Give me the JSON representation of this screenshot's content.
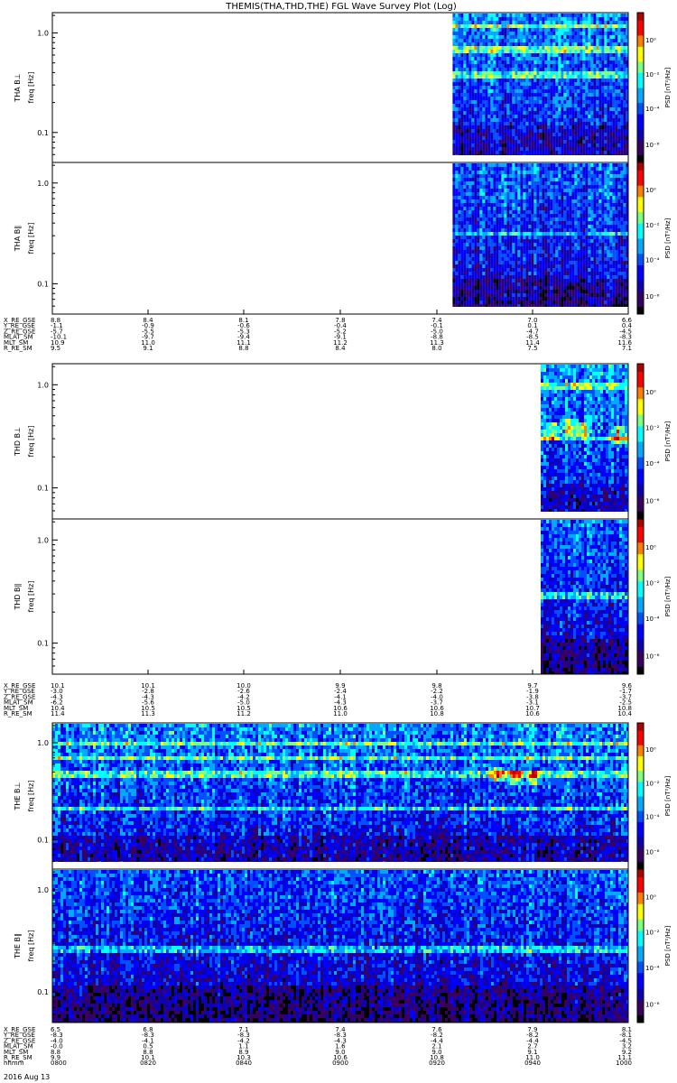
{
  "title": "THEMIS(THA,THD,THE) FGL Wave Survey Plot (Log)",
  "date_label": "2016 Aug 13",
  "chart_data": {
    "type": "heatmap",
    "y_scale": "log",
    "ylim_hz": [
      0.05,
      1.6
    ],
    "y_ticks": [
      {
        "value": 1.0,
        "label": "1.0"
      },
      {
        "value": 0.1,
        "label": "0.1"
      }
    ],
    "y_unit": "freq [Hz]",
    "colorbar": {
      "label": "PSD [nT²/Hz]",
      "scale": "log",
      "ticks": [
        {
          "value": 1,
          "label": "10⁰"
        },
        {
          "value": 0.01,
          "label": "10⁻²"
        },
        {
          "value": 0.0001,
          "label": "10⁻⁴"
        },
        {
          "value": 1e-06,
          "label": "10⁻⁶"
        }
      ],
      "colors": [
        "#000000",
        "#3a0060",
        "#1000b0",
        "#0000ff",
        "#0050ff",
        "#00a8ff",
        "#00ffff",
        "#80ff80",
        "#ffff00",
        "#ff8000",
        "#ff0000",
        "#b00000"
      ]
    },
    "x_axis": {
      "label": "hhmm",
      "ticks": [
        "0800",
        "0820",
        "0840",
        "0900",
        "0920",
        "0940",
        "1000"
      ]
    },
    "panels": [
      {
        "ylabel": "THA B⊥",
        "data_start_frac": 0.695,
        "level": 0.42,
        "bands_hz": [
          0.4,
          0.72,
          1.25
        ],
        "bursts": []
      },
      {
        "ylabel": "THA B∥",
        "data_start_frac": 0.695,
        "level": 0.38,
        "bands_hz": [
          0.33
        ],
        "bursts": []
      },
      {
        "ylabel": "THD B⊥",
        "data_start_frac": 0.848,
        "level": 0.45,
        "bands_hz": [
          0.32,
          1.0
        ],
        "bursts": [
          {
            "t": 0.865,
            "f": 0.36
          },
          {
            "t": 0.895,
            "f": 0.4
          },
          {
            "t": 0.92,
            "f": 0.38
          },
          {
            "t": 0.982,
            "f": 0.34
          }
        ]
      },
      {
        "ylabel": "THD B∥",
        "data_start_frac": 0.848,
        "level": 0.38,
        "bands_hz": [
          0.3
        ],
        "bursts": []
      },
      {
        "ylabel": "THE B⊥",
        "data_start_frac": 0.0,
        "level": 0.42,
        "bands_hz": [
          0.22,
          0.5,
          0.72,
          1.0
        ],
        "bursts": [
          {
            "t": 0.77,
            "f": 0.48
          },
          {
            "t": 0.8,
            "f": 0.46
          },
          {
            "t": 0.835,
            "f": 0.44
          }
        ]
      },
      {
        "ylabel": "THE B∥",
        "data_start_frac": 0.0,
        "level": 0.36,
        "bands_hz": [
          0.27
        ],
        "bursts": []
      }
    ],
    "ephemeris_blocks": [
      {
        "labels": [
          "X_RE_GSE",
          "Y_RE_GSE",
          "Z_RE_GSE",
          "MLAT_SM",
          "MLT_SM",
          "R_RE_SM"
        ],
        "columns": [
          [
            "8.8",
            "-1.1",
            "-5.7",
            "-10.1",
            "10.9",
            "9.5"
          ],
          [
            "8.4",
            "-0.9",
            "-5.5",
            "-9.7",
            "11.0",
            "9.1"
          ],
          [
            "8.1",
            "-0.6",
            "-5.3",
            "-9.4",
            "11.1",
            "8.8"
          ],
          [
            "7.8",
            "-0.4",
            "-5.2",
            "-9.1",
            "11.2",
            "8.4"
          ],
          [
            "7.4",
            "-0.1",
            "-5.0",
            "-8.8",
            "11.3",
            "8.0"
          ],
          [
            "7.0",
            "0.1",
            "-4.7",
            "-8.5",
            "11.4",
            "7.5"
          ],
          [
            "6.6",
            "0.4",
            "-4.5",
            "-8.3",
            "11.6",
            "7.1"
          ]
        ]
      },
      {
        "labels": [
          "X_RE_GSE",
          "Y_RE_GSE",
          "Z_RE_GSE",
          "MLAT_SM",
          "MLT_SM",
          "R_RE_SM"
        ],
        "columns": [
          [
            "10.1",
            "-3.0",
            "-4.3",
            "-6.2",
            "10.4",
            "11.4"
          ],
          [
            "10.1",
            "-2.8",
            "-4.3",
            "-5.6",
            "10.5",
            "11.3"
          ],
          [
            "10.0",
            "-2.6",
            "-4.2",
            "-5.0",
            "10.5",
            "11.2"
          ],
          [
            "9.9",
            "-2.4",
            "-4.1",
            "-4.3",
            "10.6",
            "11.0"
          ],
          [
            "9.8",
            "-2.2",
            "-4.0",
            "-3.7",
            "10.6",
            "10.8"
          ],
          [
            "9.7",
            "-1.9",
            "-3.8",
            "-3.1",
            "10.7",
            "10.6"
          ],
          [
            "9.6",
            "-1.7",
            "-3.7",
            "-2.5",
            "10.8",
            "10.4"
          ]
        ]
      },
      {
        "labels": [
          "X_RE_GSE",
          "Y_RE_GSE",
          "Z_RE_GSE",
          "MLAT_SM",
          "MLT_SM",
          "R_RE_SM",
          "hhmm"
        ],
        "columns": [
          [
            "6.5",
            "-8.3",
            "-4.0",
            "-0.0",
            "8.8",
            "9.9",
            "0800"
          ],
          [
            "6.8",
            "-8.3",
            "-4.1",
            "0.5",
            "8.8",
            "10.1",
            "0820"
          ],
          [
            "7.1",
            "-8.3",
            "-4.2",
            "1.1",
            "8.9",
            "10.3",
            "0840"
          ],
          [
            "7.4",
            "-8.3",
            "-4.3",
            "1.6",
            "9.0",
            "10.6",
            "0900"
          ],
          [
            "7.6",
            "-8.2",
            "-4.4",
            "2.1",
            "9.0",
            "10.8",
            "0920"
          ],
          [
            "7.9",
            "-8.2",
            "-4.4",
            "2.7",
            "9.1",
            "11.0",
            "0940"
          ],
          [
            "8.1",
            "-8.1",
            "-4.5",
            "3.2",
            "9.2",
            "11.1",
            "1000"
          ]
        ]
      }
    ]
  }
}
